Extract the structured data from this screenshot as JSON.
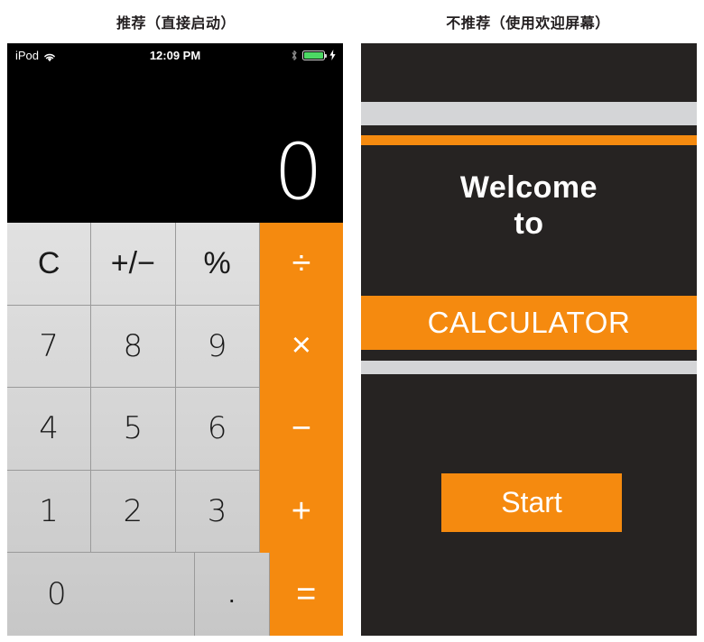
{
  "captions": {
    "left": "推荐（直接启动）",
    "right": "不推荐（使用欢迎屏幕）"
  },
  "left_phone": {
    "status_bar": {
      "carrier": "iPod",
      "wifi_icon": "wifi-icon",
      "time": "12:09 PM",
      "bluetooth_icon": "bluetooth-icon",
      "battery_icon": "battery-icon",
      "battery_level": "100",
      "charging_icon": "lightning-bolt-icon"
    },
    "display": {
      "value": "0"
    },
    "keypad": {
      "rows": [
        [
          {
            "label": "C",
            "type": "function"
          },
          {
            "label": "+/−",
            "type": "function"
          },
          {
            "label": "%",
            "type": "function"
          },
          {
            "label": "÷",
            "type": "operator"
          }
        ],
        [
          {
            "label": "7",
            "type": "number"
          },
          {
            "label": "8",
            "type": "number"
          },
          {
            "label": "9",
            "type": "number"
          },
          {
            "label": "×",
            "type": "operator"
          }
        ],
        [
          {
            "label": "4",
            "type": "number"
          },
          {
            "label": "5",
            "type": "number"
          },
          {
            "label": "6",
            "type": "number"
          },
          {
            "label": "−",
            "type": "operator"
          }
        ],
        [
          {
            "label": "1",
            "type": "number"
          },
          {
            "label": "2",
            "type": "number"
          },
          {
            "label": "3",
            "type": "number"
          },
          {
            "label": "+",
            "type": "operator"
          }
        ],
        [
          {
            "label": "0",
            "type": "number-wide"
          },
          {
            "label": ".",
            "type": "decimal"
          },
          {
            "label": "=",
            "type": "operator"
          }
        ]
      ]
    }
  },
  "right_phone": {
    "welcome_line_1": "Welcome",
    "welcome_line_2": "to",
    "app_name": "CALCULATOR",
    "start_button": "Start"
  },
  "colors": {
    "accent_orange": "#f58a0f",
    "key_gray": "#d6d6d6",
    "dark_background": "#262322",
    "band_gray": "#d4d5d7",
    "battery_green": "#4cd964",
    "caption_text": "#231f20"
  }
}
